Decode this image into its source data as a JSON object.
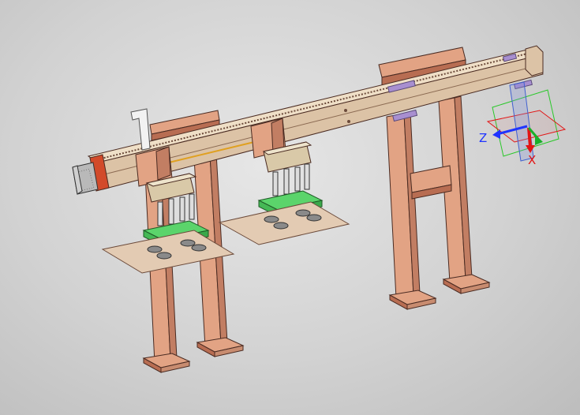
{
  "colors": {
    "background": "#d2d2d2",
    "frame": "#e2a384",
    "frame_dark": "#b86d52",
    "outline": "#4a2b22",
    "rail": "#dcc3a6",
    "rail_top": "#efdfc7",
    "plate_green": "#5bd46b",
    "card": "#e3cbb3",
    "slider": "#d9c9a8",
    "bracket_purple": "#a88fd0",
    "motor": "#b9b9b9",
    "motor_end": "#d24a2a",
    "axis_z": "#1f34ff",
    "axis_x": "#e21414",
    "axis_y": "#19b02a",
    "triad_box": "#28c828"
  },
  "triad": {
    "z_label": "Z",
    "x_label": "X"
  },
  "icons": [
    "coordinate-triad-icon"
  ]
}
